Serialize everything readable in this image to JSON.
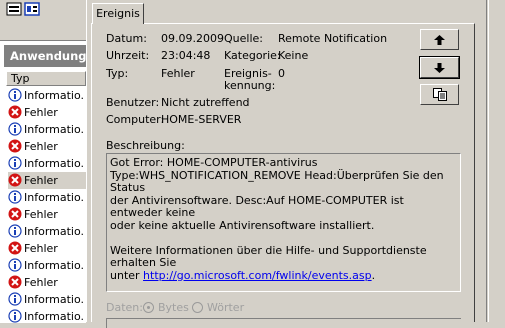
{
  "colors": {
    "error": "#d21414",
    "info": "#1a3fb5",
    "link": "#0000ee"
  },
  "left_pane": {
    "header": "Anwendung",
    "column": "Typ",
    "rows": [
      {
        "type": "info",
        "label": "Informatio."
      },
      {
        "type": "error",
        "label": "Fehler"
      },
      {
        "type": "info",
        "label": "Informatio."
      },
      {
        "type": "error",
        "label": "Fehler"
      },
      {
        "type": "info",
        "label": "Informatio."
      },
      {
        "type": "error",
        "label": "Fehler"
      },
      {
        "type": "info",
        "label": "Informatio."
      },
      {
        "type": "error",
        "label": "Fehler"
      },
      {
        "type": "info",
        "label": "Informatio."
      },
      {
        "type": "error",
        "label": "Fehler"
      },
      {
        "type": "info",
        "label": "Informatio."
      },
      {
        "type": "error",
        "label": "Fehler"
      },
      {
        "type": "info",
        "label": "Informatio."
      },
      {
        "type": "info",
        "label": "Informatio."
      }
    ],
    "selected_index": 5
  },
  "dialog": {
    "tab": "Ereignis",
    "labels": {
      "date": "Datum:",
      "time": "Uhrzeit:",
      "type": "Typ:",
      "user": "Benutzer:",
      "computer": "Computer:",
      "source": "Quelle:",
      "category": "Kategorie:",
      "event_id_1": "Ereignis-",
      "event_id_2": "kennung:",
      "description": "Beschreibung:"
    },
    "values": {
      "date": "09.09.2009",
      "time": "23:04:48",
      "type": "Fehler",
      "user": "Nicht zutreffend",
      "computer": "HOME-SERVER",
      "source": "Remote Notification",
      "category": "Keine",
      "event_id": "0"
    },
    "description": {
      "line1": "Got Error: HOME-COMPUTER-antivirus",
      "line2": "Type:WHS_NOTIFICATION_REMOVE Head:Überprüfen Sie den Status",
      "line3": "der Antivirensoftware. Desc:Auf HOME-COMPUTER ist entweder keine",
      "line4": "oder keine aktuelle Antivirensoftware installiert.",
      "line5": "Weitere Informationen über die Hilfe- und Supportdienste erhalten Sie",
      "line6_prefix": "unter ",
      "link": "http://go.microsoft.com/fwlink/events.asp",
      "line6_suffix": "."
    },
    "data_section": {
      "label": "Daten:",
      "option_bytes": "Bytes",
      "option_words": "Wörter",
      "selected": "Bytes"
    },
    "buttons": {
      "up": "up-arrow-icon",
      "down": "down-arrow-icon",
      "copy": "copy-icon"
    }
  }
}
